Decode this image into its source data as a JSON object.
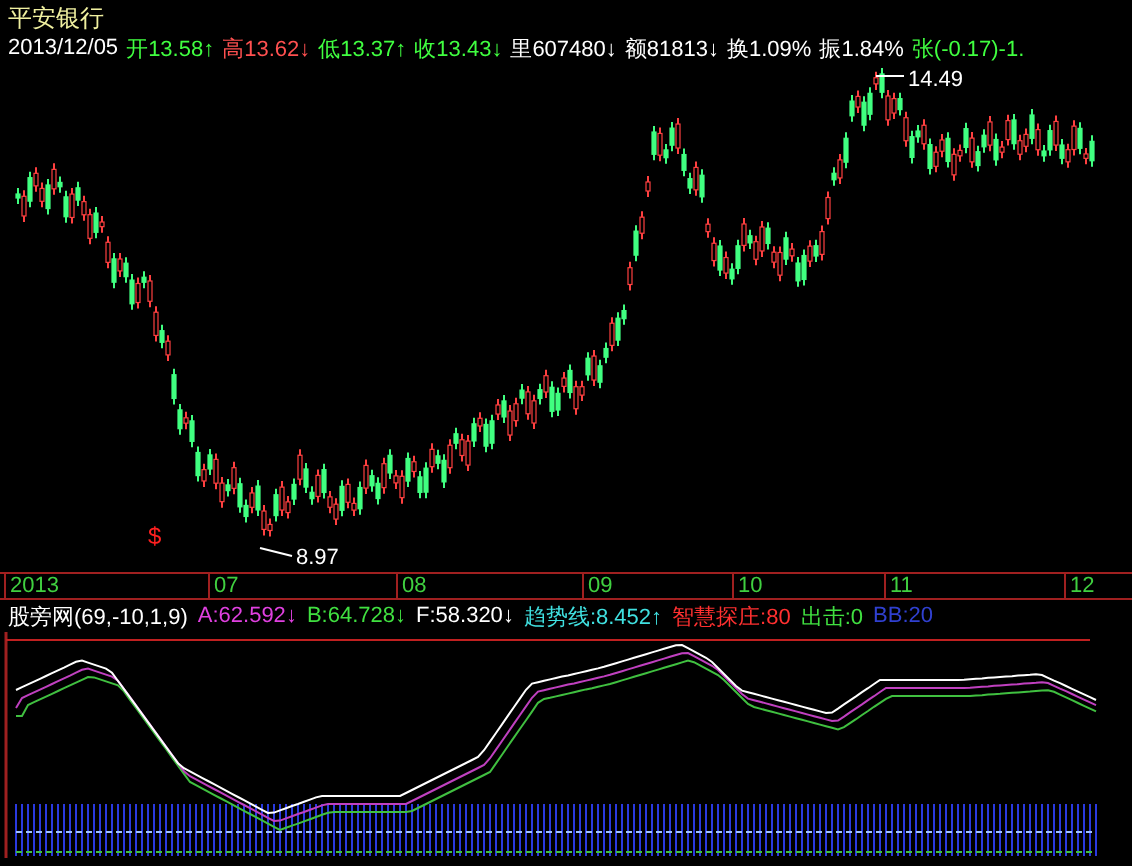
{
  "title": "平安银行",
  "date": "2013/12/05",
  "quotes": [
    {
      "label": "开",
      "value": "13.58",
      "arrow": "↑",
      "color": "#40ff40"
    },
    {
      "label": "高",
      "value": "13.62",
      "arrow": "↓",
      "color": "#ff5050"
    },
    {
      "label": "低",
      "value": "13.37",
      "arrow": "↑",
      "color": "#40ff40"
    },
    {
      "label": "收",
      "value": "13.43",
      "arrow": "↓",
      "color": "#40ff40"
    },
    {
      "label": "里",
      "value": "607480",
      "arrow": "↓",
      "color": "#ffffff"
    },
    {
      "label": "额",
      "value": "81813",
      "arrow": "↓",
      "color": "#ffffff"
    },
    {
      "label": "换",
      "value": "1.09%",
      "color": "#ffffff"
    },
    {
      "label": "振",
      "value": "1.84%",
      "color": "#ffffff"
    },
    {
      "label": "张",
      "value": "(-0.17)-1.",
      "color": "#40ff40"
    }
  ],
  "chart": {
    "high_label": "14.49",
    "low_label": "8.97",
    "signal_mark": "$"
  },
  "x_axis": [
    "2013",
    "07",
    "08",
    "09",
    "10",
    "11",
    "12"
  ],
  "indicator": {
    "name": "股旁网(69,-10,1,9)",
    "values": [
      {
        "label": "A:",
        "value": "62.592",
        "arrow": "↓",
        "color": "#e040e0"
      },
      {
        "label": "B:",
        "value": "64.728",
        "arrow": "↓",
        "color": "#40e040"
      },
      {
        "label": "F:",
        "value": "58.320",
        "arrow": "↓",
        "color": "#ffffff"
      },
      {
        "label": "趋势线:",
        "value": "8.452",
        "arrow": "↑",
        "color": "#40e0e0"
      },
      {
        "label": "智慧探庄:",
        "value": "80",
        "color": "#ff3030"
      },
      {
        "label": "出击:",
        "value": "0",
        "color": "#40e040"
      },
      {
        "label": "BB:",
        "value": "20",
        "color": "#3040d0"
      }
    ]
  }
}
